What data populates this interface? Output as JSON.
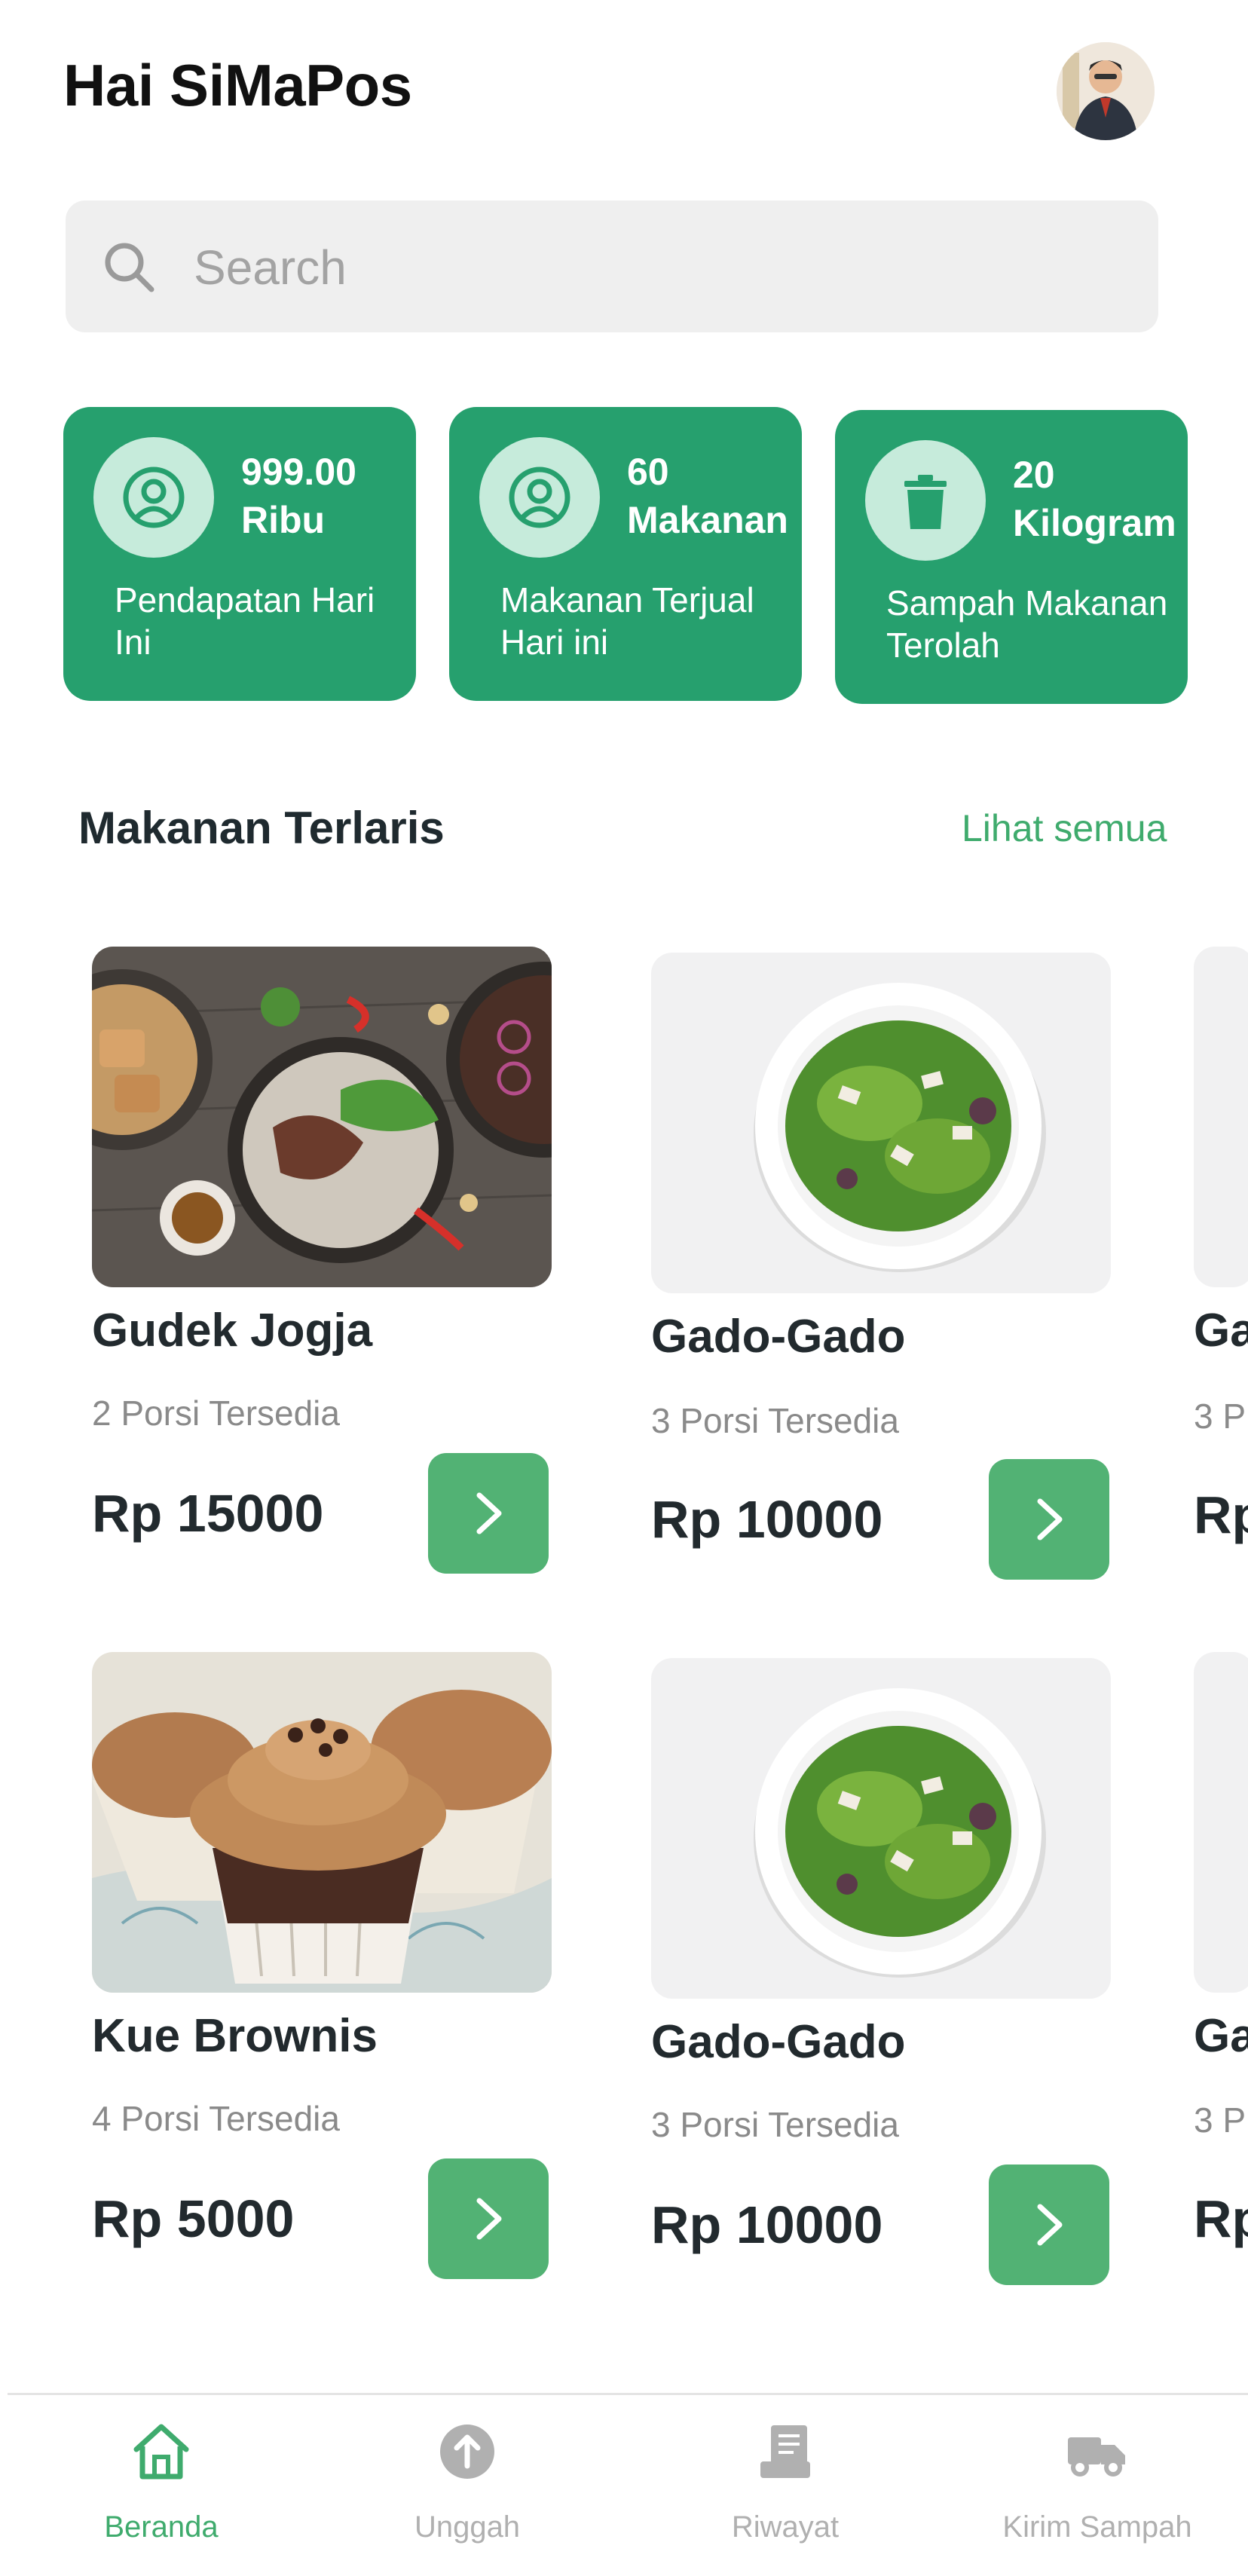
{
  "header": {
    "greeting": "Hai SiMaPos"
  },
  "search": {
    "placeholder": "Search"
  },
  "stats": [
    {
      "value": "999.00 Ribu",
      "label": "Pendapatan Hari Ini",
      "icon": "user-circle-icon"
    },
    {
      "value": "60 Makanan",
      "label": "Makanan Terjual Hari ini",
      "icon": "user-circle-icon"
    },
    {
      "value": "20 Kilogram",
      "label": "Sampah Makanan Terolah",
      "icon": "trash-icon"
    }
  ],
  "section": {
    "title": "Makanan Terlaris",
    "see_all": "Lihat semua"
  },
  "foods": [
    {
      "name": "Gudek Jogja",
      "stock": "2 Porsi Tersedia",
      "price": "Rp 15000",
      "image": "food-platter"
    },
    {
      "name": "Gado-Gado",
      "stock": "3 Porsi Tersedia",
      "price": "Rp 10000",
      "image": "salad-plate"
    },
    {
      "name": "Ga",
      "stock": "3 P",
      "price": "Rp",
      "image": "salad-plate"
    },
    {
      "name": "Kue Brownis",
      "stock": "4 Porsi Tersedia",
      "price": "Rp 5000",
      "image": "cupcakes"
    },
    {
      "name": "Gado-Gado",
      "stock": "3 Porsi Tersedia",
      "price": "Rp 10000",
      "image": "salad-plate"
    },
    {
      "name": "Ga",
      "stock": "3 P",
      "price": "Rp",
      "image": "salad-plate"
    }
  ],
  "nav": [
    {
      "label": "Beranda",
      "icon": "home-icon",
      "active": true
    },
    {
      "label": "Unggah",
      "icon": "upload-icon",
      "active": false
    },
    {
      "label": "Riwayat",
      "icon": "history-icon",
      "active": false
    },
    {
      "label": "Kirim Sampah",
      "icon": "truck-icon",
      "active": false
    }
  ],
  "colors": {
    "primary": "#26a06e",
    "accent": "#3fab6d",
    "button": "#52b274"
  }
}
